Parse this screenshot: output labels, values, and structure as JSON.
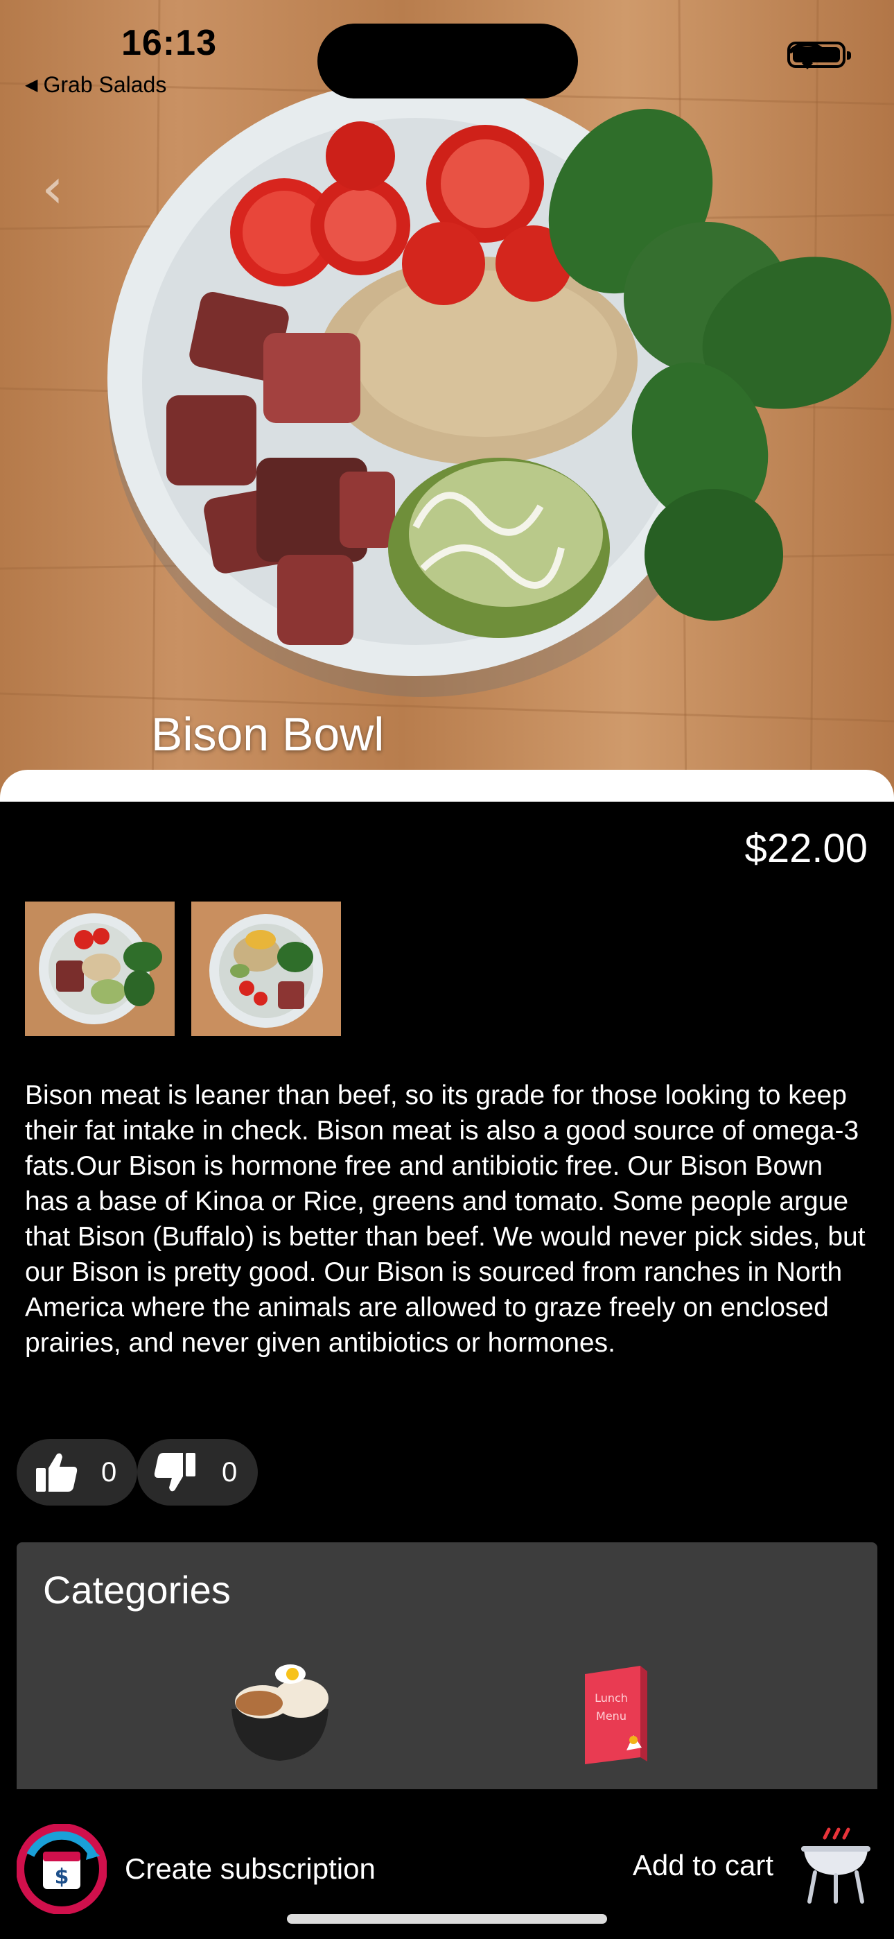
{
  "status_bar": {
    "time": "16:13",
    "back_app": "Grab Salads"
  },
  "product": {
    "title": "Bison Bowl",
    "price": "$22.00",
    "description": "Bison meat is leaner than beef, so its grade for those looking to keep their fat intake in check. Bison meat is also a good source of omega-3 fats.Our Bison is hormone free and antibiotic free. Our Bison Bown has a base of Kinoa or Rice, greens and tomato. Some people argue that Bison (Buffalo) is better than beef. We would never pick sides, but our Bison is pretty good. Our Bison is sourced from ranches in North America where the animals are allowed to graze freely on enclosed prairies, and never given antibiotics or hormones.",
    "likes": "0",
    "dislikes": "0"
  },
  "categories": {
    "title": "Categories",
    "items": [
      {
        "icon": "bowl-icon"
      },
      {
        "icon": "lunch-menu-icon",
        "text_line1": "Lunch",
        "text_line2": "Menu"
      }
    ]
  },
  "bottom_bar": {
    "subscription_label": "Create subscription",
    "cart_label": "Add to cart"
  },
  "colors": {
    "background": "#000000",
    "card": "#3d3d3d",
    "pill": "#2a2a2a",
    "subscription_ring_red": "#d0104c",
    "subscription_ring_blue": "#1aa0d8"
  }
}
